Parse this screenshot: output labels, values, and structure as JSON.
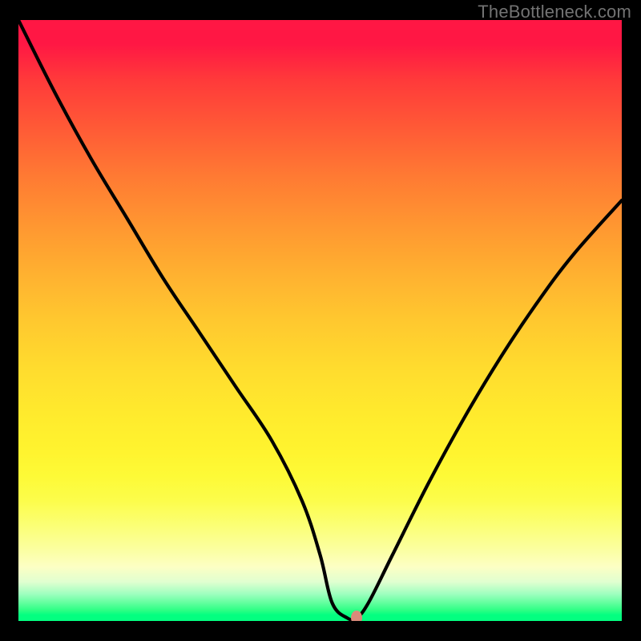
{
  "watermark": "TheBottleneck.com",
  "chart_data": {
    "type": "line",
    "title": "",
    "xlabel": "",
    "ylabel": "",
    "xlim": [
      0,
      100
    ],
    "ylim": [
      0,
      100
    ],
    "series": [
      {
        "name": "bottleneck-curve",
        "x": [
          0,
          6,
          12,
          18,
          24,
          30,
          36,
          42,
          47,
          50,
          52,
          54.5,
          56,
          58,
          62,
          68,
          74,
          80,
          86,
          92,
          100
        ],
        "values": [
          100,
          88,
          77,
          67,
          57,
          48,
          39,
          30,
          20,
          11,
          3,
          0.5,
          0.5,
          3,
          11,
          23,
          34,
          44,
          53,
          61,
          70
        ]
      }
    ],
    "marker": {
      "x": 56,
      "y": 0.5,
      "color": "#d88a7a"
    },
    "background_gradient": {
      "top": "#ff1744",
      "mid": "#ffeb2d",
      "bottom": "#03ff80"
    }
  }
}
